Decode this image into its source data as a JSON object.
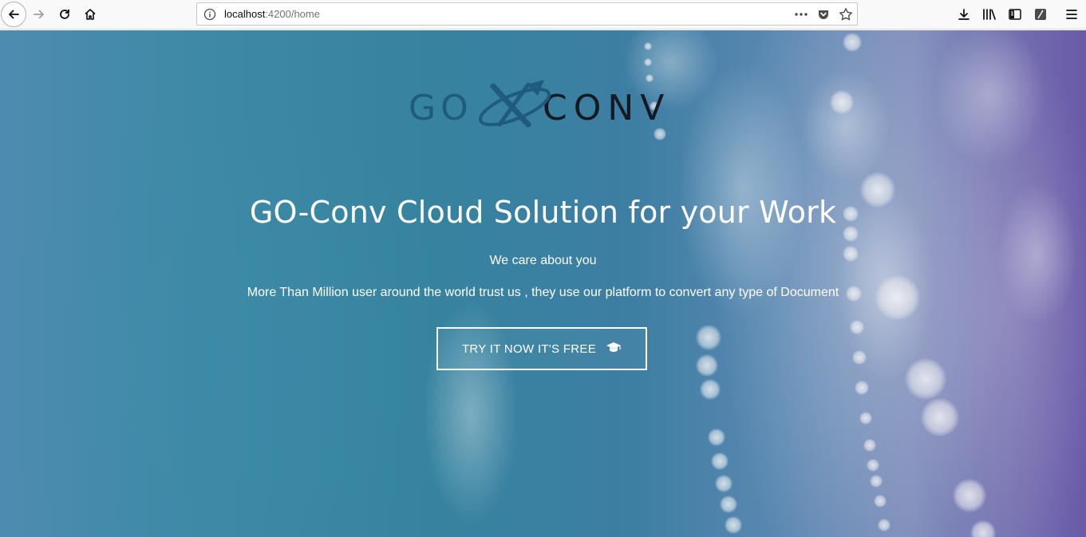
{
  "browser": {
    "url_host": "localhost",
    "url_rest": ":4200/home",
    "icons": {
      "back": "back-arrow-icon",
      "forward": "forward-arrow-icon",
      "reload": "reload-icon",
      "home": "home-icon",
      "site_info": "info-icon",
      "page_actions": "more-dots-icon",
      "pocket": "pocket-icon",
      "bookmark": "star-icon",
      "downloads": "download-icon",
      "library": "library-icon",
      "sidebar": "sidebar-icon",
      "screenshot": "screenshot-icon",
      "menu": "hamburger-menu-icon"
    }
  },
  "hero": {
    "logo_left": "GO",
    "logo_right": "CONV",
    "title": "GO-Conv Cloud Solution for your Work",
    "subtitle": "We care about you",
    "description": "More Than Million user around the world trust us , they use our platform to convert any type of Document",
    "cta_label": "TRY IT NOW IT'S FREE",
    "cta_icon": "graduation-cap-icon"
  },
  "colors": {
    "logo_blue": "#1f5b7e",
    "logo_dark": "#141a1f",
    "text": "#ffffff"
  }
}
